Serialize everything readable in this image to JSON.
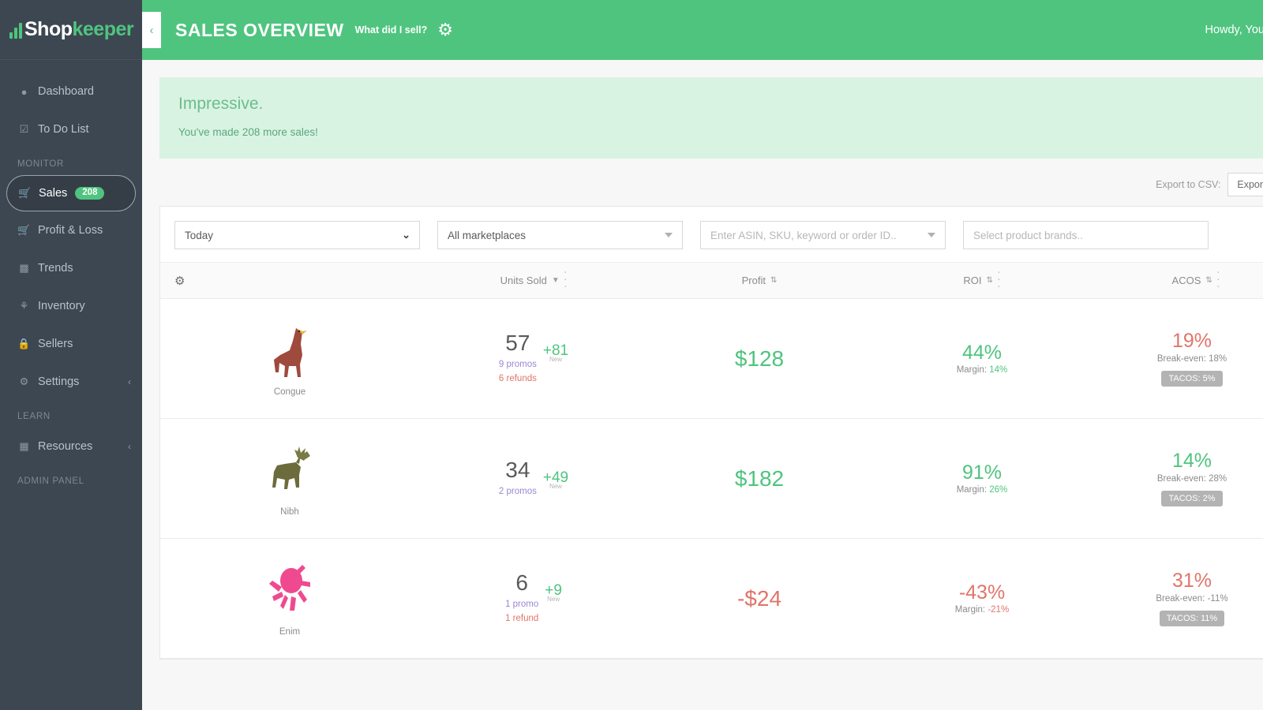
{
  "brand": {
    "part1": "Shop",
    "part2": "keeper"
  },
  "header": {
    "collapse_icon": "chevron-left-icon",
    "title": "SALES OVERVIEW",
    "subtitle": "What did I sell?",
    "gear_icon": "gear-icon",
    "greeting": "Howdy, You",
    "avatar": "user-avatar"
  },
  "sidebar": {
    "items": [
      {
        "label": "Dashboard",
        "icon": "dashboard-icon",
        "type": "link"
      },
      {
        "label": "To Do List",
        "icon": "checklist-icon",
        "type": "link"
      },
      {
        "label": "MONITOR",
        "type": "section"
      },
      {
        "label": "Sales",
        "icon": "cart-icon",
        "type": "link",
        "badge": "208",
        "active": true
      },
      {
        "label": "Profit & Loss",
        "icon": "cart-icon",
        "type": "link"
      },
      {
        "label": "Trends",
        "icon": "chart-icon",
        "type": "link"
      },
      {
        "label": "Inventory",
        "icon": "boxes-icon",
        "type": "link"
      },
      {
        "label": "Sellers",
        "icon": "lock-icon",
        "type": "link"
      },
      {
        "label": "Settings",
        "icon": "gear-icon",
        "type": "link",
        "caret": "chevron-left-icon"
      },
      {
        "label": "LEARN",
        "type": "section"
      },
      {
        "label": "Resources",
        "icon": "grid-icon",
        "type": "link",
        "caret": "chevron-left-icon"
      },
      {
        "label": "ADMIN PANEL",
        "type": "section"
      }
    ]
  },
  "alert": {
    "title": "Impressive.",
    "text": "You've made 208 more sales!",
    "close_icon": "close-icon"
  },
  "export": {
    "label": "Export to CSV:",
    "button": "Export Now"
  },
  "filters": {
    "date_range": "Today",
    "marketplace": "All marketplaces",
    "search_placeholder": "Enter ASIN, SKU, keyword or order ID..",
    "brands_placeholder": "Select product brands.."
  },
  "table": {
    "columns": [
      {
        "label": "",
        "icon": "gear-icon"
      },
      {
        "label": "Units Sold",
        "sort": "desc"
      },
      {
        "label": "Profit",
        "sort": "both"
      },
      {
        "label": "ROI",
        "sort": "both"
      },
      {
        "label": "ACOS",
        "sort": "both"
      }
    ],
    "rows": [
      {
        "product": "Congue",
        "image": "llama-image",
        "units": "57",
        "units_new": "+81",
        "units_new_label": "New",
        "promos": "9 promos",
        "refunds": "6 refunds",
        "profit": "$128",
        "profit_sign": "pos",
        "roi": "44%",
        "roi_sign": "pos",
        "margin_label": "Margin:",
        "margin_value": "14%",
        "margin_sign": "pos",
        "acos": "19%",
        "acos_sign": "neg",
        "breakeven": "Break-even: 18%",
        "tacos": "TACOS: 5%"
      },
      {
        "product": "Nibh",
        "image": "moose-image",
        "units": "34",
        "units_new": "+49",
        "units_new_label": "New",
        "promos": "2 promos",
        "refunds": "",
        "profit": "$182",
        "profit_sign": "pos",
        "roi": "91%",
        "roi_sign": "pos",
        "margin_label": "Margin:",
        "margin_value": "26%",
        "margin_sign": "pos",
        "acos": "14%",
        "acos_sign": "pos",
        "breakeven": "Break-even: 28%",
        "tacos": "TACOS: 2%"
      },
      {
        "product": "Enim",
        "image": "octopus-image",
        "units": "6",
        "units_new": "+9",
        "units_new_label": "New",
        "promos": "1 promo",
        "refunds": "1 refund",
        "profit": "-$24",
        "profit_sign": "neg",
        "roi": "-43%",
        "roi_sign": "neg",
        "margin_label": "Margin:",
        "margin_value": "-21%",
        "margin_sign": "neg",
        "acos": "31%",
        "acos_sign": "neg",
        "breakeven": "Break-even: -11%",
        "tacos": "TACOS: 11%"
      }
    ]
  },
  "colors": {
    "brand_green": "#4fc47f",
    "sidebar": "#3d4751",
    "negative": "#e0756a",
    "promo": "#9b87d4",
    "alert_bg": "#d9f3e3"
  }
}
